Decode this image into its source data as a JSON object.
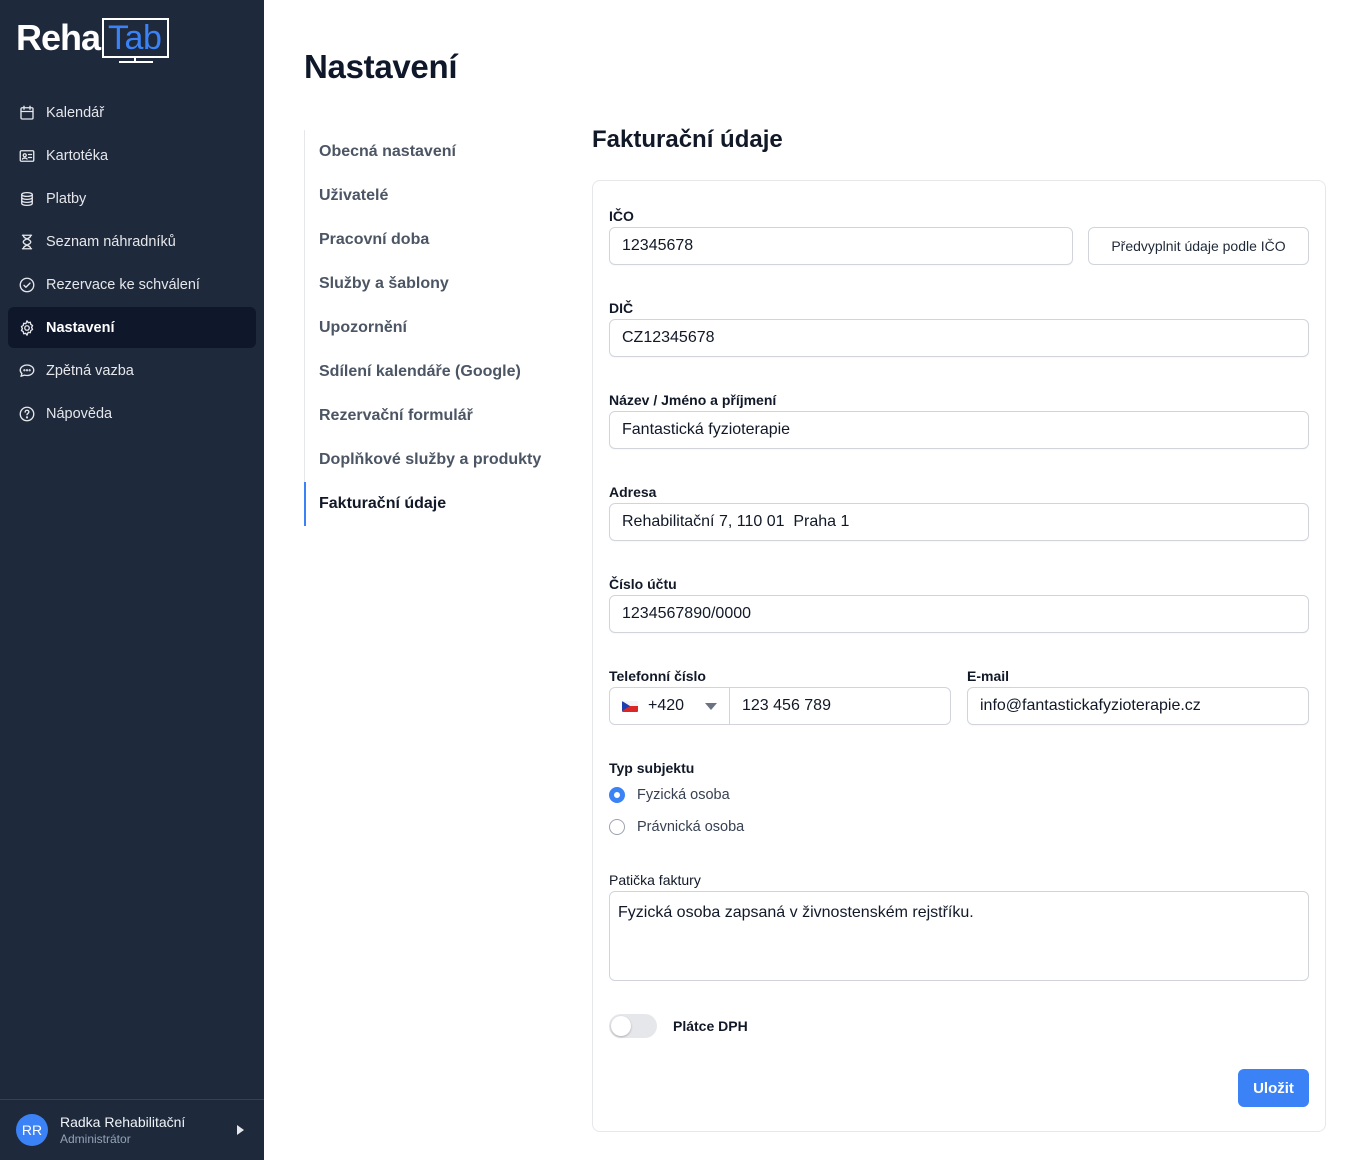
{
  "logo": {
    "part1": "Reha",
    "part2": "Tab"
  },
  "sidebar": {
    "items": [
      {
        "label": "Kalendář",
        "icon": "calendar-icon"
      },
      {
        "label": "Kartotéka",
        "icon": "id-card-icon"
      },
      {
        "label": "Platby",
        "icon": "coins-icon"
      },
      {
        "label": "Seznam náhradníků",
        "icon": "hourglass-icon"
      },
      {
        "label": "Rezervace ke schválení",
        "icon": "check-circle-icon"
      },
      {
        "label": "Nastavení",
        "icon": "gear-icon",
        "active": true
      },
      {
        "label": "Zpětná vazba",
        "icon": "chat-bubble-icon"
      },
      {
        "label": "Nápověda",
        "icon": "question-circle-icon"
      }
    ]
  },
  "user": {
    "initials": "RR",
    "name": "Radka Rehabilitační",
    "role": "Administrátor"
  },
  "page": {
    "title": "Nastavení"
  },
  "subnav": {
    "items": [
      "Obecná nastavení",
      "Uživatelé",
      "Pracovní doba",
      "Služby a šablony",
      "Upozornění",
      "Sdílení kalendáře (Google)",
      "Rezervační formulář",
      "Doplňkové služby a produkty",
      "Fakturační údaje"
    ],
    "active_index": 8
  },
  "form": {
    "title": "Fakturační údaje",
    "ico": {
      "label": "IČO",
      "value": "12345678",
      "prefill_button": "Předvyplnit údaje podle IČO"
    },
    "dic": {
      "label": "DIČ",
      "value": "CZ12345678"
    },
    "name": {
      "label": "Název / Jméno a příjmení",
      "value": "Fantastická fyzioterapie"
    },
    "address": {
      "label": "Adresa",
      "value": "Rehabilitační 7, 110 01  Praha 1"
    },
    "account": {
      "label": "Číslo účtu",
      "value": "1234567890/0000"
    },
    "phone": {
      "label": "Telefonní číslo",
      "country_code": "+420",
      "value": "123 456 789"
    },
    "email": {
      "label": "E-mail",
      "value": "info@fantastickafyzioterapie.cz"
    },
    "subject_type": {
      "label": "Typ subjektu",
      "options": [
        "Fyzická osoba",
        "Právnická osoba"
      ],
      "selected": "Fyzická osoba"
    },
    "footer": {
      "label": "Patička faktury",
      "value": "Fyzická osoba zapsaná v živnostenském rejstříku."
    },
    "vat_payer": {
      "label": "Plátce DPH",
      "enabled": false
    },
    "save_button": "Uložit"
  },
  "colors": {
    "sidebar_bg": "#1e293b",
    "accent": "#3b82f6",
    "active_nav_bg": "#0f172a"
  }
}
